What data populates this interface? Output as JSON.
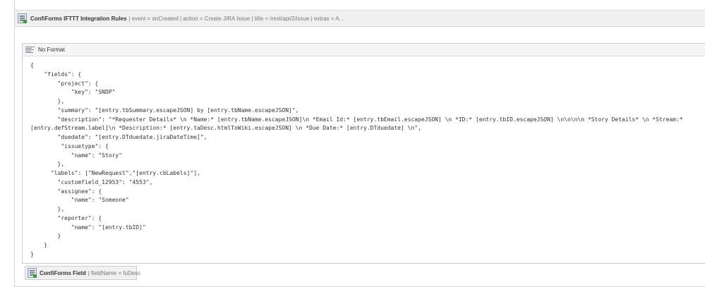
{
  "ifttt_macro": {
    "title": "ConfiForms IFTTT Integration Rules",
    "params": "| event = onCreated | action = Create JIRA Issue | title = /rest/api/2/issue | extras = A..."
  },
  "no_format": {
    "title": "No Format",
    "code": "{\n    \"fields\": {\n        \"project\": {\n            \"key\": \"SNDP\"\n        },\n        \"summary\": \"[entry.tbSummary.escapeJSON] by [entry.tbName.escapeJSON]\",\n        \"description\": \"*Requester Details* \\n *Name:* [entry.tbName.escapeJSON]\\n *Email Id:* [entry.tbEmail.escapeJSON] \\n *ID:* [entry.tbID.escapeJSON] \\n\\n\\n\\n *Story Details* \\n *Stream:*\n[entry.defStream.label]\\n *Description:* [entry.taDesc.htmlToWiki.escapeJSON] \\n *Due Date:* [entry.DTduedate] \\n\",\n        \"duedate\": \"[entry.DTduedate.jiraDateTime]\",\n         \"issuetype\": {\n            \"name\": \"Story\"\n        },\n      \"labels\": [\"NewRequest\",\"[entry.cbLabels]\"],\n        \"customfield_12953\": \"4553\",\n        \"assignee\": {\n            \"name\": \"Someone\"\n        },\n        \"reporter\": {\n            \"name\": \"[entry.tbID]\"\n        }\n    }\n}"
  },
  "field_macro": {
    "title": "ConfiForms Field",
    "params": "| fieldName = fuDesc"
  },
  "icons": {
    "plugin": "confiforms-macro-icon",
    "no_format": "no-format-icon"
  }
}
